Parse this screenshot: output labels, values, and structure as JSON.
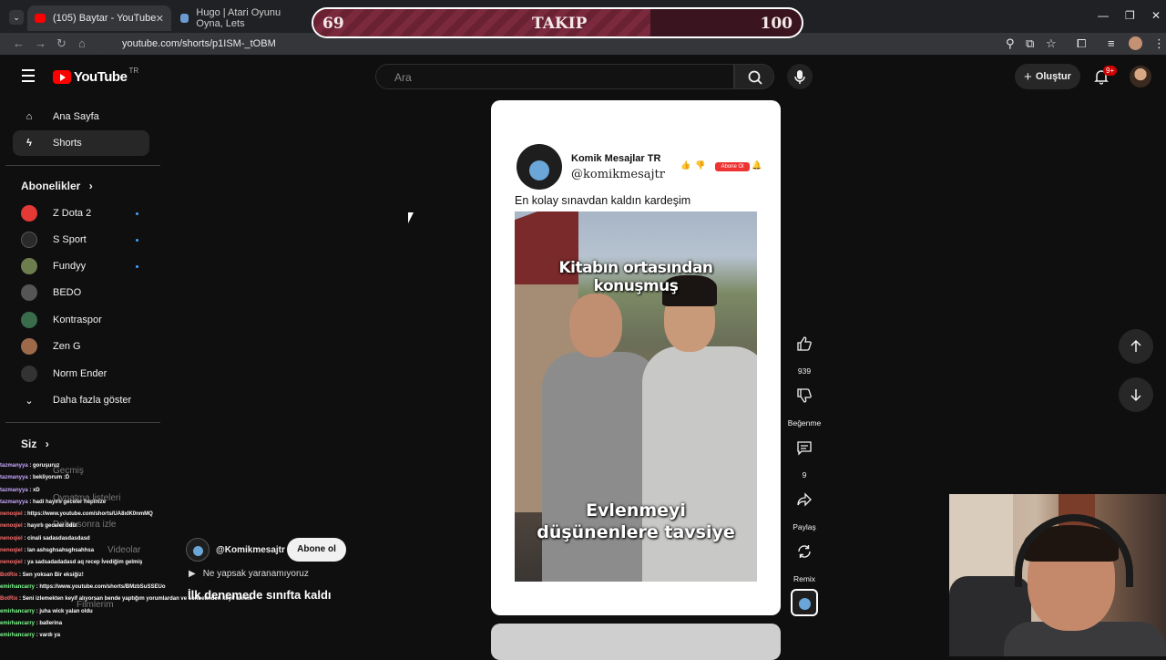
{
  "browser": {
    "tabs": [
      {
        "title": "(105) Baytar - YouTube",
        "active": true
      },
      {
        "title": "Hugo | Atari Oyunu Oyna, Lets",
        "active": false
      }
    ],
    "url": "youtube.com/shorts/p1ISM-_tOBM"
  },
  "takip_overlay": {
    "current": "69",
    "label": "TAKIP",
    "goal": "100",
    "progress": 0.69
  },
  "header": {
    "logo_text": "YouTube",
    "country": "TR",
    "search_placeholder": "Ara",
    "create_label": "Oluştur",
    "notifications": "9+"
  },
  "sidebar": {
    "main": [
      {
        "label": "Ana Sayfa",
        "icon": "home-icon"
      },
      {
        "label": "Shorts",
        "icon": "shorts-icon",
        "active": true
      }
    ],
    "subs_heading": "Abonelikler",
    "subscriptions": [
      {
        "label": "Z Dota 2",
        "color": "#e53935",
        "new": true
      },
      {
        "label": "S Sport",
        "color": "#2a2a2a",
        "new": true
      },
      {
        "label": "Fundyy",
        "color": "#6e7d4e",
        "new": true
      },
      {
        "label": "BEDO",
        "color": "#555555",
        "new": false
      },
      {
        "label": "Kontraspor",
        "color": "#3a6b4b",
        "new": false
      },
      {
        "label": "Zen G",
        "color": "#9c6a4a",
        "new": false
      },
      {
        "label": "Norm Ender",
        "color": "#333333",
        "new": false
      }
    ],
    "show_more": "Daha fazla göster",
    "you_heading": "Siz",
    "you_items_ghost": [
      "Geçmiş",
      "Oynatma listeleri",
      "Daha sonra izle",
      "Videolar",
      "Filmlerim"
    ]
  },
  "short": {
    "post_name": "Komik Mesajlar TR",
    "post_handle": "@komikmesajtr",
    "post_subscribe": "Abone Ol",
    "caption": "En kolay sınavdan kaldın kardeşim",
    "photo_caption_top": "Kitabın ortasından konuşmuş",
    "photo_caption_bottom_1": "Evlenmeyi",
    "photo_caption_bottom_2": "düşünenlere tavsiye",
    "channel_handle": "@Komikmesajtr",
    "subscribe_label": "Abone ol",
    "sound_label": "Ne yapsak yaranamıyoruz",
    "title": "İlk denemede sınıfta kaldı"
  },
  "actions": {
    "likes": "939",
    "dislike_label": "Beğenme",
    "comments": "9",
    "share_label": "Paylaş",
    "remix_label": "Remix"
  },
  "chat": [
    {
      "user": "tazmanyya",
      "msg": ": goruşuruz",
      "color": "#c7a6ff"
    },
    {
      "user": "tazmanyya",
      "msg": ": bekliyorum :D",
      "color": "#c7a6ff"
    },
    {
      "user": "tazmanyya",
      "msg": ": xD",
      "color": "#c7a6ff"
    },
    {
      "user": "tazmanyya",
      "msg": ": hadi hayırlı geceler hepinize",
      "color": "#c7a6ff"
    },
    {
      "user": "nenoqiel",
      "msg": ": https://www.youtube.com/shorts/UA8xIK0nmMQ",
      "color": "#ff6b6b"
    },
    {
      "user": "nenoqiel",
      "msg": ": hayırlı geceler ödül",
      "color": "#ff6b6b"
    },
    {
      "user": "nenoqiel",
      "msg": ": cinali sadasdasdasdasd",
      "color": "#ff6b6b"
    },
    {
      "user": "nenoqiel",
      "msg": ": lan ashsghsahsghsahhsa",
      "color": "#ff6b6b"
    },
    {
      "user": "nenoqiel",
      "msg": ": ya sadsadadadasd aq recep İvediğim gelmiş",
      "color": "#ff6b6b"
    },
    {
      "user": "BotRix",
      "msg": ": Sen yoksan Bir eksiğiz!",
      "color": "#ff6b6b"
    },
    {
      "user": "emirhancarry",
      "msg": ": https://www.youtube.com/shorts/BMzbSuSSEUo",
      "color": "#7dff8f"
    },
    {
      "user": "BotRix",
      "msg": ": Seni izlemekten keyif alıyorsan bende yaptığım yorumlardan ve sohbetinden keyif alırım.",
      "color": "#ff6b6b"
    },
    {
      "user": "emirhancarry",
      "msg": ": juha wick yalan oldu",
      "color": "#7dff8f"
    },
    {
      "user": "emirhancarry",
      "msg": ": ballerina",
      "color": "#7dff8f"
    },
    {
      "user": "emirhancarry",
      "msg": ": vardı ya",
      "color": "#7dff8f"
    }
  ]
}
